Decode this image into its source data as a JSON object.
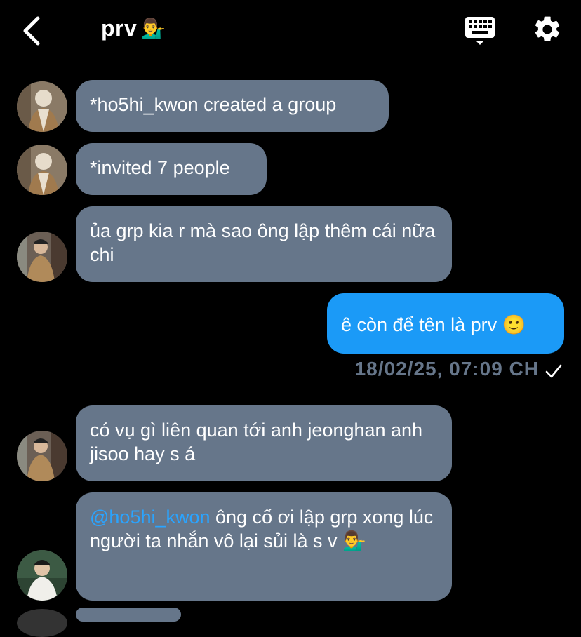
{
  "header": {
    "title": "prv",
    "title_emoji": "💁‍♂️"
  },
  "messages": [
    {
      "text": "*ho5hi_kwon created a group"
    },
    {
      "text": "*invited 7 people"
    },
    {
      "text": "ủa grp kia r mà sao ông lập thêm cái nữa chi"
    },
    {
      "text": "ê còn để tên là prv 🙂"
    },
    {
      "text": "có vụ gì liên quan tới anh jeonghan anh jisoo hay s á"
    },
    {
      "mention": "@ho5hi_kwon",
      "text": " ông cố ơi lập grp xong lúc người ta nhắn vô lại sủi là s v 💁‍♂️"
    }
  ],
  "timestamp": "18/02/25, 07:09 CH",
  "colors": {
    "incoming_bubble": "#66768a",
    "outgoing_bubble": "#1b9af7",
    "mention": "#2aa4ff",
    "background": "#000000"
  },
  "icons": [
    "back-chevron-icon",
    "keyboard-icon",
    "settings-gear-icon",
    "check-icon"
  ]
}
